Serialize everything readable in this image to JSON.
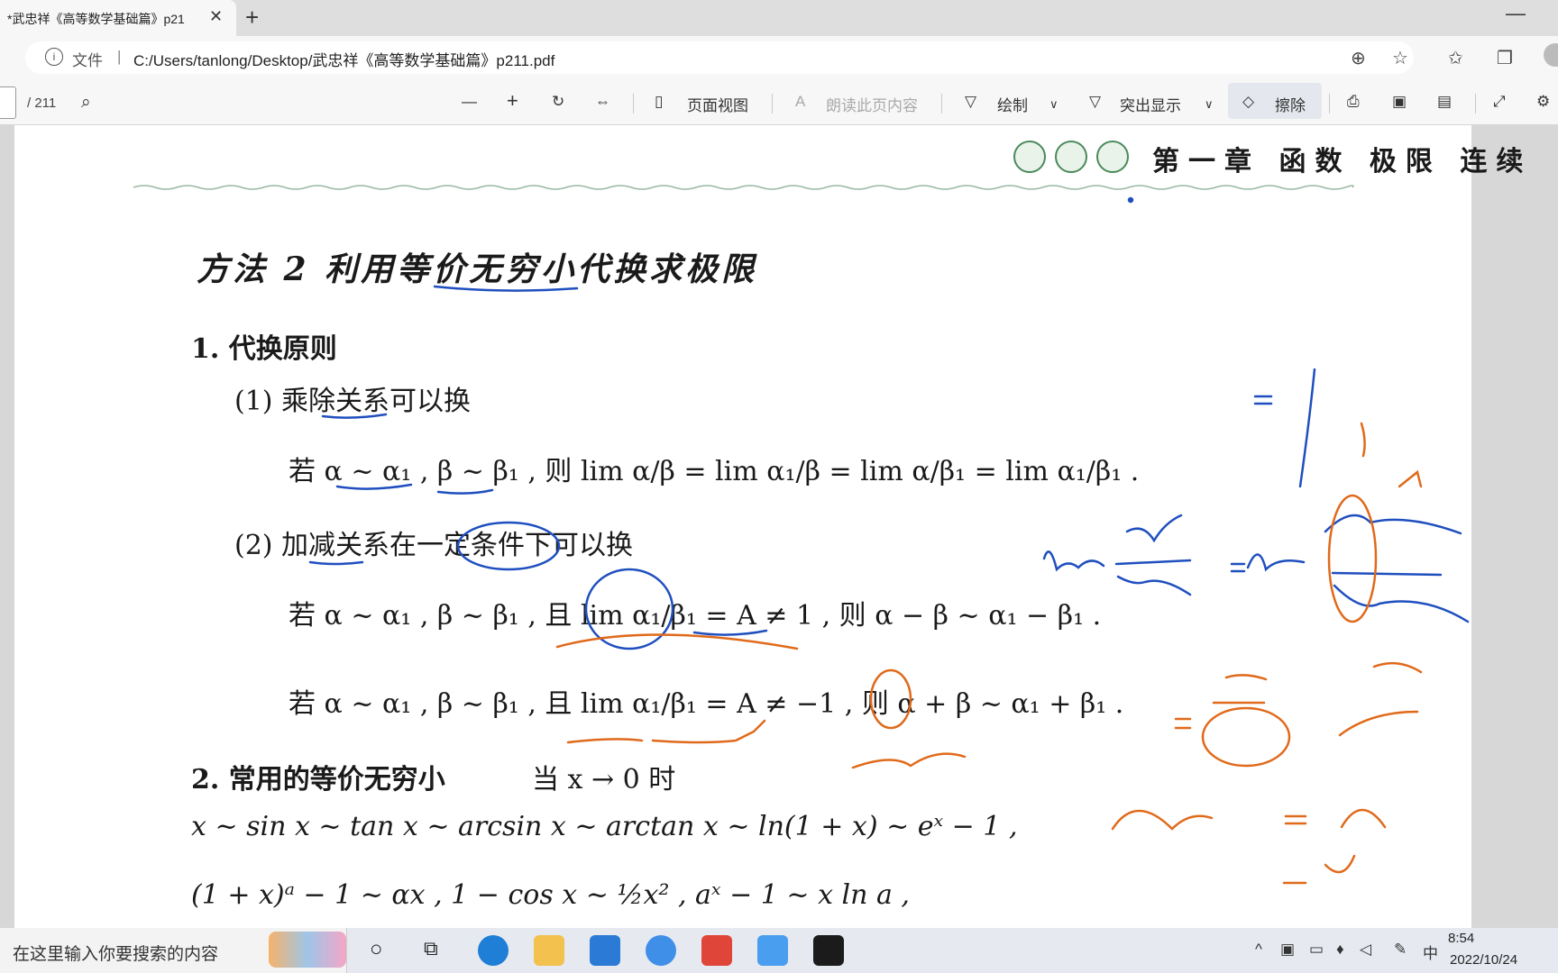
{
  "browser": {
    "tab_title": "*武忠祥《高等数学基础篇》p21",
    "close_tab": "✕",
    "new_tab": "+",
    "minimize": "—",
    "file_label": "文件",
    "separator": "|",
    "url": "C:/Users/tanlong/Desktop/武忠祥《高等数学基础篇》p211.pdf"
  },
  "pdf_toolbar": {
    "page_total": "/ 211",
    "zoom_out": "—",
    "zoom_in": "+",
    "page_view": "页面视图",
    "read_aloud": "朗读此页内容",
    "draw": "绘制",
    "highlight": "突出显示",
    "erase": "擦除"
  },
  "document": {
    "chapter_header": "第一章 函数 极限 连续",
    "method_title": "方法 2   利用等价无穷小代换求极限",
    "section1_title": "1. 代换原则",
    "rule1": "(1) 乘除关系可以换",
    "rule1_formula": "若 α ~ α₁ , β ~ β₁ , 则 lim α/β = lim α₁/β = lim α/β₁ = lim α₁/β₁ .",
    "rule2": "(2) 加减关系在一定条件下可以换",
    "rule2_formula1": "若 α ~ α₁ , β ~ β₁ , 且 lim α₁/β₁ = A ≠ 1 , 则 α − β ~ α₁ − β₁ .",
    "rule2_formula2": "若 α ~ α₁ , β ~ β₁ , 且 lim α₁/β₁ = A ≠ −1 , 则 α + β ~ α₁ + β₁ .",
    "section2_title": "2. 常用的等价无穷小",
    "section2_condition": "当 x → 0 时",
    "equiv_line1": "x ~ sin x ~ tan x ~ arcsin x ~ arctan x ~ ln(1 + x) ~ eˣ − 1 ,",
    "equiv_line2": "(1 + x)ᵃ − 1 ~ αx ,   1 − cos x ~ ½x² ,   aˣ − 1 ~ x ln a ,"
  },
  "taskbar": {
    "search_placeholder": "在这里输入你要搜索的内容",
    "ime": "中",
    "time": "8:54",
    "date": "2022/10/24"
  },
  "colors": {
    "ink_blue": "#1f4fbf",
    "ink_orange": "#e06a1b",
    "page_bg": "#ffffff",
    "viewer_bg": "#d7d7d7"
  }
}
